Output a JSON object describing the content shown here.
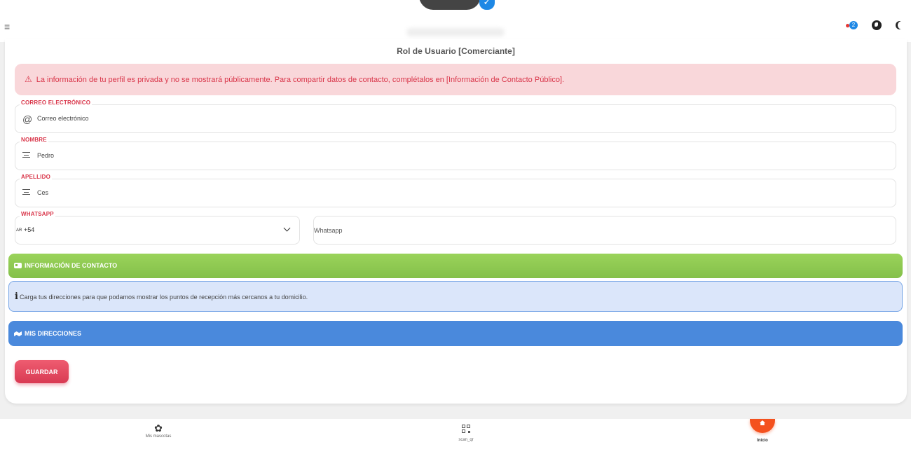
{
  "header": {
    "menu_icon": "menu-icon",
    "notification_count": "2",
    "icons": [
      "bell-icon",
      "globe-icon",
      "moon-icon"
    ]
  },
  "profile": {
    "role": "Rol de Usuario [Comerciante]"
  },
  "alert": {
    "text": "La información de tu perfil es privada y no se mostrará públicamente. Para compartir datos de contacto, complétalos en [Información de Contacto Público]."
  },
  "form": {
    "email": {
      "label": "CORREO ELECTRÓNICO",
      "value": "Correo electrónico"
    },
    "first_name": {
      "label": "NOMBRE",
      "value": "Pedro"
    },
    "last_name": {
      "label": "APELLIDO",
      "value": "Ces"
    },
    "whatsapp": {
      "label": "WHATSAPP",
      "country_flag": "AR",
      "country_code": "+54",
      "placeholder": "Whatsapp"
    }
  },
  "sections": {
    "contact_info": "INFORMACIÓN DE CONTACTO",
    "info_note": "Carga tus direcciones para que podamos mostrar los puntos de recepción más cercanos a tu domicilio.",
    "addresses": "MIS DIRECCIONES"
  },
  "actions": {
    "save": "GUARDAR"
  },
  "bottom_nav": {
    "items": [
      {
        "label": "Mis mascotas",
        "icon": "paw-icon"
      },
      {
        "label": "scan_qr",
        "icon": "qr-icon"
      },
      {
        "label": "Inicio",
        "icon": "home-icon"
      }
    ]
  },
  "colors": {
    "accent_red": "#d9364a",
    "alert_bg": "#f9d7da",
    "contact_green": "#8bc34a",
    "info_bg": "#dbe6fa",
    "addresses_blue": "#4a89dc",
    "home_orange": "#f4511e"
  }
}
